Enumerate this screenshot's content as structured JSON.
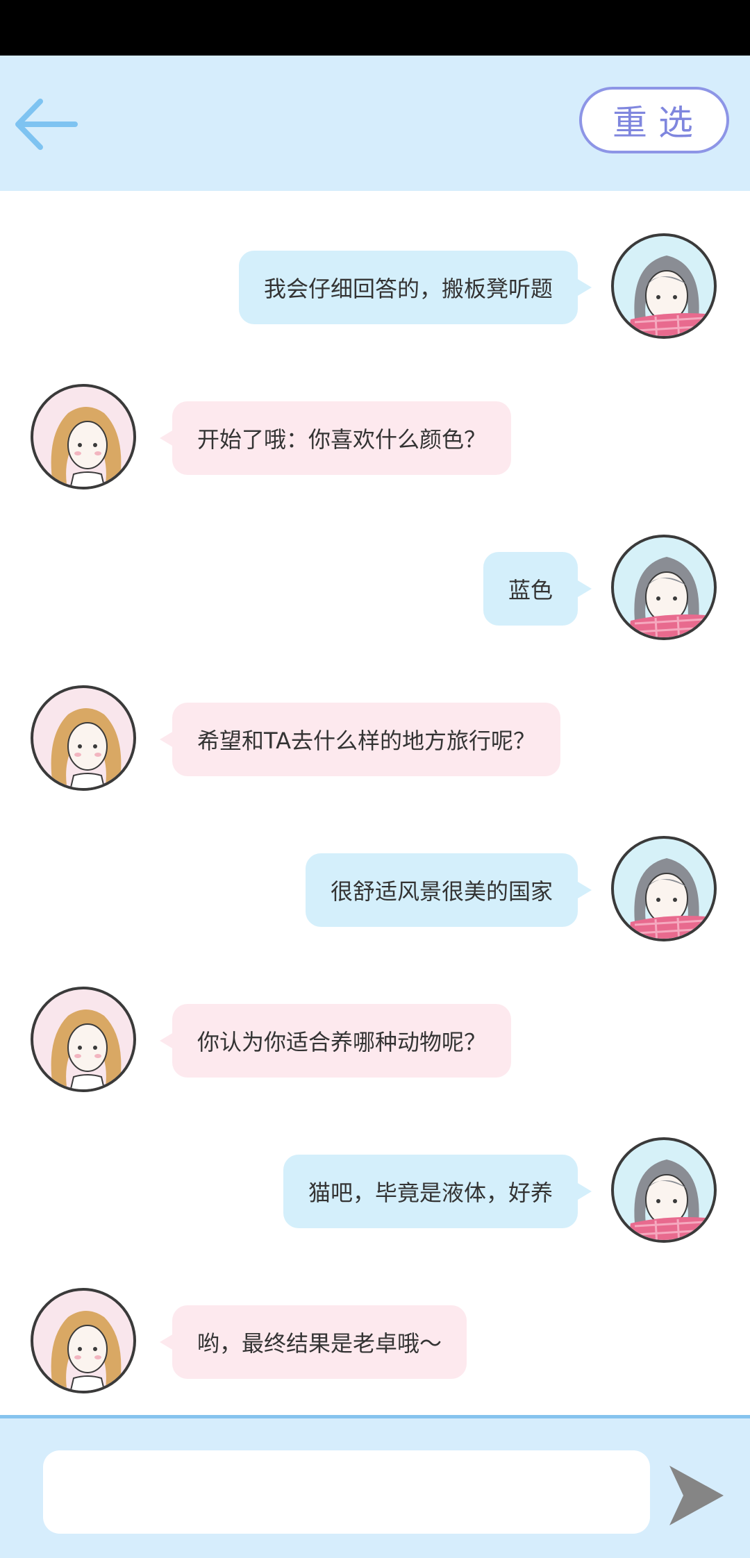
{
  "header": {
    "back_icon": "arrow-left-icon",
    "reselect_label": "重选",
    "accent_color": "#7ec3f1",
    "reselect_color": "#8d95e6"
  },
  "messages": [
    {
      "side": "right",
      "speaker": "user",
      "text": "我会仔细回答的，搬板凳听题"
    },
    {
      "side": "left",
      "speaker": "host",
      "text": "开始了哦：你喜欢什么颜色？"
    },
    {
      "side": "right",
      "speaker": "user",
      "text": "蓝色"
    },
    {
      "side": "left",
      "speaker": "host",
      "text": "希望和TA去什么样的地方旅行呢？"
    },
    {
      "side": "right",
      "speaker": "user",
      "text": "很舒适风景很美的国家"
    },
    {
      "side": "left",
      "speaker": "host",
      "text": "你认为你适合养哪种动物呢？"
    },
    {
      "side": "right",
      "speaker": "user",
      "text": "猫吧，毕竟是液体，好养"
    },
    {
      "side": "left",
      "speaker": "host",
      "text": "哟，最终结果是老卓哦～"
    }
  ],
  "input": {
    "placeholder": "",
    "value": "",
    "send_icon": "send-arrow-icon"
  },
  "colors": {
    "user_bubble": "#d4effb",
    "host_bubble": "#fde9ee",
    "header_bg": "#d6edfc"
  }
}
